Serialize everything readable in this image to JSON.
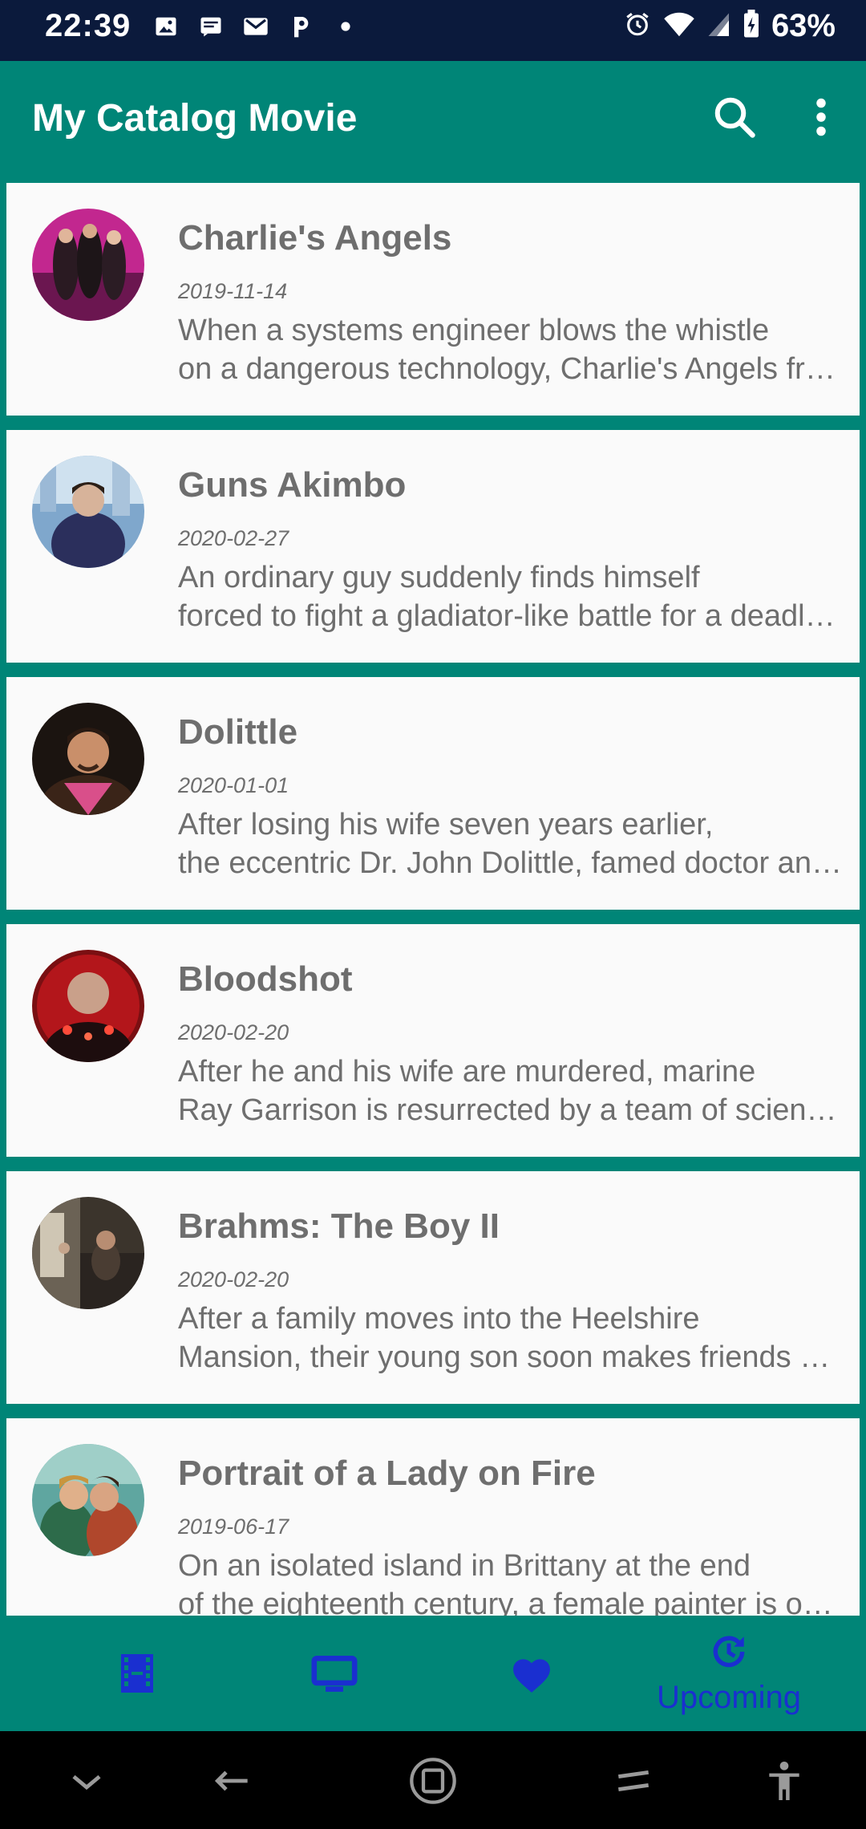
{
  "status_bar": {
    "time": "22:39",
    "battery": "63%"
  },
  "app_bar": {
    "title": "My Catalog Movie"
  },
  "movies": [
    {
      "title": "Charlie's Angels",
      "date": "2019-11-14",
      "overview_1": "When a systems engineer blows the whistle",
      "overview_2": "on a dangerous technology, Charlie's Angels from across the globe are called into action."
    },
    {
      "title": "Guns Akimbo",
      "date": "2020-02-27",
      "overview_1": "An ordinary guy suddenly finds himself",
      "overview_2": "forced to fight a gladiator-like battle for a deadly game."
    },
    {
      "title": "Dolittle",
      "date": "2020-01-01",
      "overview_1": "After losing his wife seven years earlier,",
      "overview_2": "the eccentric Dr. John Dolittle, famed doctor and veterinarian of Queen Victoria's England."
    },
    {
      "title": "Bloodshot",
      "date": "2020-02-20",
      "overview_1": "After he and his wife are murdered, marine",
      "overview_2": "Ray Garrison is resurrected by a team of scientists."
    },
    {
      "title": "Brahms: The Boy II",
      "date": "2020-02-20",
      "overview_1": "After a family moves into the Heelshire",
      "overview_2": "Mansion, their young son soon makes friends with a lifelike doll."
    },
    {
      "title": "Portrait of a Lady on Fire",
      "date": "2019-06-17",
      "overview_1": "On an isolated island in Brittany at the end",
      "overview_2": "of the eighteenth century, a female painter is obliged to paint a wedding portrait."
    }
  ],
  "bottom_nav": {
    "active_label": "Upcoming"
  },
  "icons": {
    "movies": "film-icon",
    "tv": "tv-icon",
    "favorite": "heart-icon",
    "upcoming": "history-icon"
  },
  "colors": {
    "primary": "#008577",
    "nav_icon": "#1a2fd0",
    "card_bg": "#fafafa",
    "text": "#6e6e6e"
  }
}
